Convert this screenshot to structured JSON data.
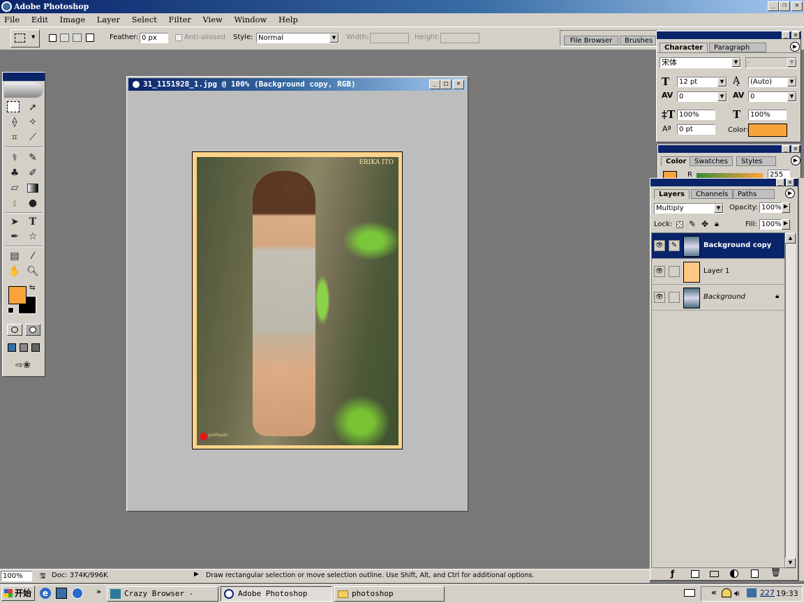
{
  "app": {
    "title": "Adobe Photoshop"
  },
  "menu": [
    "File",
    "Edit",
    "Image",
    "Layer",
    "Select",
    "Filter",
    "View",
    "Window",
    "Help"
  ],
  "options": {
    "feather_label": "Feather:",
    "feather_value": "0 px",
    "antialias_label": "Anti-aliased",
    "style_label": "Style:",
    "style_value": "Normal",
    "width_label": "Width:",
    "height_label": "Height:"
  },
  "palette_well": {
    "tabs": [
      "File Browser",
      "Brushes"
    ]
  },
  "document": {
    "title": "31_1151928_1.jpg @ 100% (Background copy, RGB)",
    "photo_caption": "ERIKA ITO",
    "photo_sign": "yoshiyuki"
  },
  "colors": {
    "foreground": "#f9a43a",
    "background": "#000000",
    "selection_title": "#0a246a"
  },
  "character": {
    "tabs": [
      "Character",
      "Paragraph"
    ],
    "font": "宋体",
    "font_style": "-",
    "size": "12 pt",
    "leading": "(Auto)",
    "kerning": "0",
    "tracking": "0",
    "vscale": "100%",
    "hscale": "100%",
    "baseline": "0 pt",
    "color_label": "Color:"
  },
  "color_panel": {
    "tabs": [
      "Color",
      "Swatches",
      "Styles"
    ],
    "r_label": "R",
    "r_value": "255"
  },
  "layers": {
    "tabs": [
      "Layers",
      "Channels",
      "Paths"
    ],
    "blend": "Multiply",
    "opacity_label": "Opacity:",
    "opacity": "100%",
    "lock_label": "Lock:",
    "fill_label": "Fill:",
    "fill": "100%",
    "items": [
      {
        "name": "Background copy",
        "selected": true
      },
      {
        "name": "Layer 1",
        "selected": false
      },
      {
        "name": "Background",
        "selected": false,
        "locked": true
      }
    ]
  },
  "status": {
    "zoom": "100%",
    "doc": "Doc: 374K/996K",
    "hint": "Draw rectangular selection or move selection outline.  Use Shift, Alt, and Ctrl for additional options."
  },
  "taskbar": {
    "start": "开始",
    "tasks": [
      "Crazy Browser - [这...",
      "Adobe Photoshop",
      "photoshop"
    ],
    "tray_num": "227",
    "time": "19:33"
  }
}
